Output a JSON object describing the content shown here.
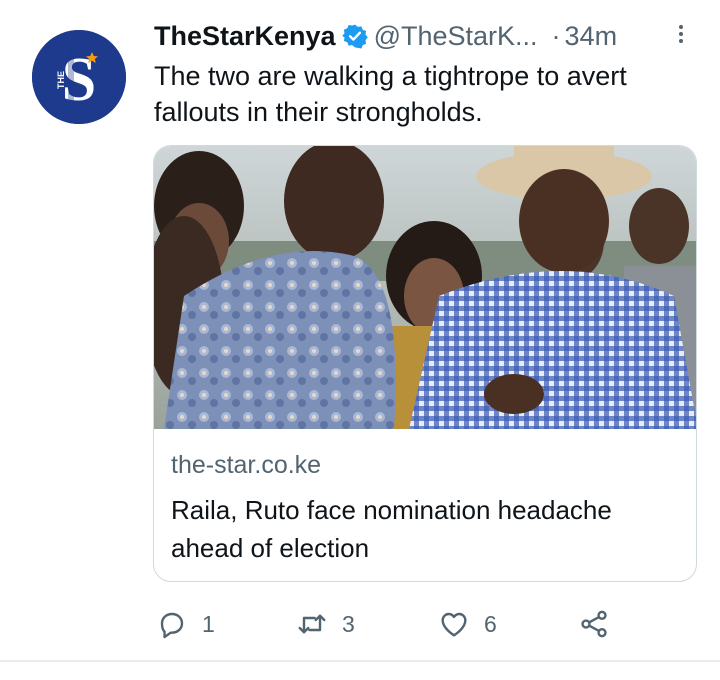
{
  "tweet": {
    "display_name": "TheStarKenya",
    "handle": "@TheStarK...",
    "separator": "·",
    "time": "34m",
    "text": "The two are walking a tightrope to avert fallouts in their strongholds.",
    "avatar_letters": "S",
    "avatar_small_text": "THE",
    "verified_icon": "verified-badge-icon",
    "more_icon": "more-vertical-icon"
  },
  "card": {
    "domain": "the-star.co.ke",
    "title": "Raila, Ruto face nomination headache ahead of election"
  },
  "actions": {
    "reply": {
      "icon": "reply-icon",
      "count": "1"
    },
    "retweet": {
      "icon": "retweet-icon",
      "count": "3"
    },
    "like": {
      "icon": "heart-icon",
      "count": "6"
    },
    "share": {
      "icon": "share-icon"
    }
  },
  "colors": {
    "text_primary": "#0f1419",
    "text_secondary": "#536471",
    "verified_blue": "#1d9bf0",
    "avatar_blue": "#1d3a8c",
    "border": "#cfd9de"
  }
}
